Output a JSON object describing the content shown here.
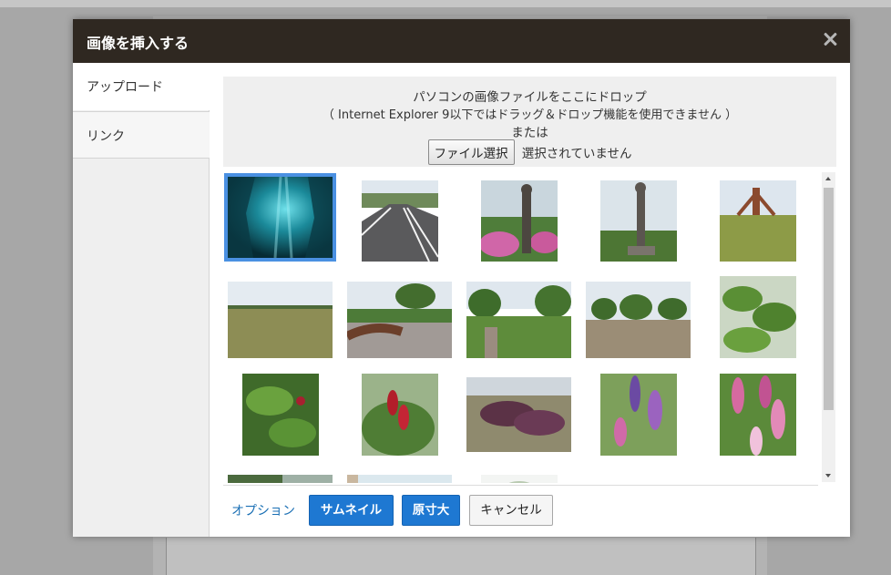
{
  "dialog": {
    "title": "画像を挿入する"
  },
  "tabs": [
    {
      "label": "アップロード"
    },
    {
      "label": "リンク"
    }
  ],
  "dropzone": {
    "line1": "パソコンの画像ファイルをここにドロップ",
    "line2": "（ Internet Explorer 9以下ではドラッグ＆ドロップ機能を使用できません ）",
    "line3": "または",
    "file_button": "ファイル選択",
    "file_status": "選択されていません"
  },
  "footer": {
    "options_link": "オプション",
    "thumbnail_button": "サムネイル",
    "fullsize_button": "原寸大",
    "cancel_button": "キャンセル"
  },
  "colors": {
    "titlebar": "#2f2821",
    "selection": "#4a90e2",
    "primary_button": "#1e78d2",
    "link": "#1a6fb4"
  }
}
